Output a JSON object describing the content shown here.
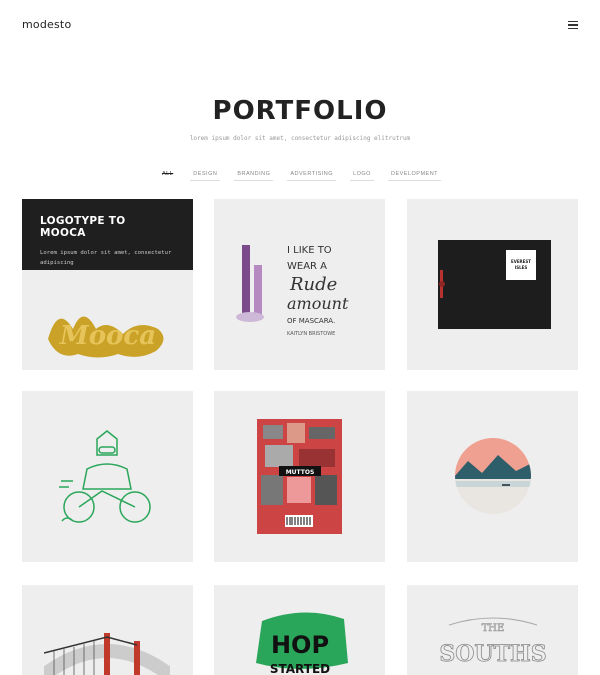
{
  "header": {
    "brand": "modesto",
    "menu_icon": "hamburger-menu-icon"
  },
  "hero": {
    "title": "PORTFOLIO",
    "subtitle": "lorem ipsum dolor sit amet, consectetur adipiscing elitrutrum"
  },
  "filters": [
    "ALL",
    "DESIGN",
    "BRANDING",
    "ADVERTISING",
    "LOGO",
    "DEVELOPMENT"
  ],
  "active_filter": "ALL",
  "featured": {
    "title": "LOGOTYPE TO MOOCA",
    "description": "Lorem ipsum dolor sit amet, consectetur adipiscing",
    "artwork_text": "Mooca"
  },
  "artwork_text": {
    "mascara": [
      "I LIKE TO",
      "WEAR A",
      "Rude",
      "amount",
      "OF MASCARA.",
      "KAITLYN BRISTOWE"
    ],
    "booklet": [
      "EVEREST",
      "ISLES"
    ],
    "magazine": "MUTTOS",
    "poster_1": "HOP",
    "poster_2": "STARTED",
    "lettering_1": "THE",
    "lettering_2": "SOUTHS"
  },
  "colors": {
    "background": "#ffffff",
    "tile": "#eeeeee",
    "overlay": "#1f1f1f",
    "gold": "#c9a227",
    "green": "#2aa65a",
    "red": "#c0392b"
  }
}
